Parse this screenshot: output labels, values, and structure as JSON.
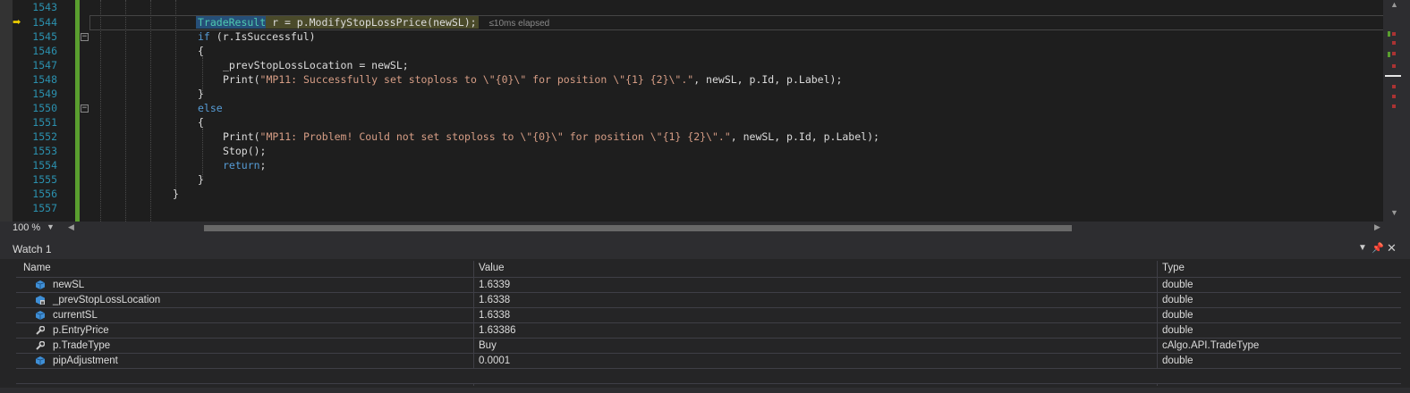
{
  "editor": {
    "lines": [
      {
        "num": "1543",
        "code": ""
      },
      {
        "num": "1544",
        "code": ""
      },
      {
        "num": "1545",
        "code": ""
      },
      {
        "num": "1546",
        "code": ""
      },
      {
        "num": "1547",
        "code": ""
      },
      {
        "num": "1548",
        "code": ""
      },
      {
        "num": "1549",
        "code": ""
      },
      {
        "num": "1550",
        "code": ""
      },
      {
        "num": "1551",
        "code": ""
      },
      {
        "num": "1552",
        "code": ""
      },
      {
        "num": "1553",
        "code": ""
      },
      {
        "num": "1554",
        "code": ""
      },
      {
        "num": "1555",
        "code": ""
      },
      {
        "num": "1556",
        "code": ""
      },
      {
        "num": "1557",
        "code": ""
      }
    ],
    "code_1544_type": "TradeResult",
    "code_1544_rest": " r = p.ModifyStopLossPrice(newSL);",
    "perf_tip": "≤10ms elapsed",
    "code_1545_kw": "if",
    "code_1545_rest": " (r.IsSuccessful)",
    "brace_open": "{",
    "brace_close": "}",
    "code_1547": "_prevStopLossLocation = newSL;",
    "code_print": "Print(",
    "code_1548_str": "\"MP11: Successfully set stoploss to \\\"{0}\\\" for position \\\"{1} {2}\\\".\"",
    "code_print_args": ", newSL, p.Id, p.Label);",
    "code_1550_kw": "else",
    "code_1552_str": "\"MP11: Problem! Could not set stoploss to \\\"{0}\\\" for position \\\"{1} {2}\\\".\"",
    "code_1553": "Stop();",
    "code_1554_kw": "return",
    "semicolon": ";",
    "fold_minus": "−"
  },
  "statusbar": {
    "zoom": "100 %"
  },
  "watch": {
    "title": "Watch 1",
    "columns": {
      "name": "Name",
      "value": "Value",
      "type": "Type"
    },
    "rows": [
      {
        "name": "newSL",
        "value": "1.6339",
        "type": "double",
        "icon": "field-icon"
      },
      {
        "name": "_prevStopLossLocation",
        "value": "1.6338",
        "type": "double",
        "icon": "private-field-icon"
      },
      {
        "name": "currentSL",
        "value": "1.6338",
        "type": "double",
        "icon": "field-icon"
      },
      {
        "name": "p.EntryPrice",
        "value": "1.63386",
        "type": "double",
        "icon": "property-wrench-icon"
      },
      {
        "name": "p.TradeType",
        "value": "Buy",
        "type": "cAlgo.API.TradeType",
        "icon": "property-wrench-icon"
      },
      {
        "name": "pipAdjustment",
        "value": "0.0001",
        "type": "double",
        "icon": "field-icon"
      }
    ]
  },
  "colors": {
    "keyword": "#569cd6",
    "string": "#d69d85",
    "type": "#4ec9b0",
    "line_number": "#2b91af",
    "change_bar": "#5a9e2f"
  }
}
